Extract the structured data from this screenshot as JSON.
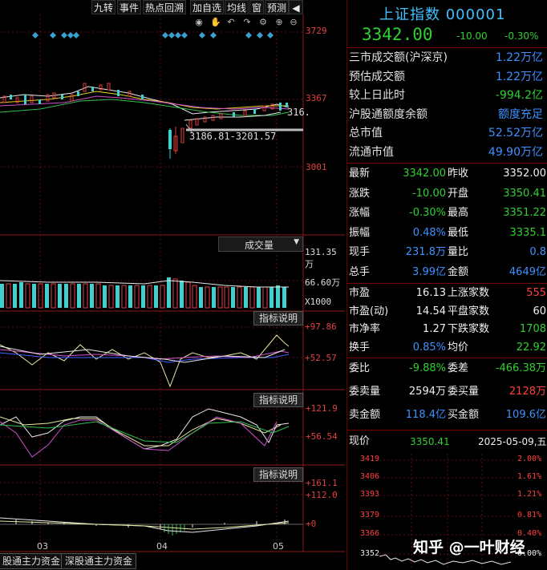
{
  "toolbar": {
    "buttons": [
      "九转",
      "事件",
      "热点回溯",
      "加自选",
      "均线",
      "窗",
      "预测"
    ],
    "icons": [
      "eye-icon",
      "hand-icon",
      "undo-icon",
      "redo-icon",
      "settings-icon",
      "zoom-in-icon",
      "zoom-out-icon"
    ]
  },
  "kline": {
    "y_labels": [
      "3729",
      "3367",
      "3001"
    ],
    "ma_label": "316.",
    "range_label": "3186.81-3201.57"
  },
  "volume": {
    "selector": "成交量",
    "y_labels": [
      "131.35万",
      "66.60万",
      "X1000"
    ]
  },
  "indicator1": {
    "button": "指标说明",
    "y_labels": [
      "+97.86",
      "+52.57"
    ]
  },
  "indicator2": {
    "button": "指标说明",
    "y_labels": [
      "+121.9",
      "+56.54"
    ]
  },
  "indicator3": {
    "button": "指标说明",
    "y_labels": [
      "+161.1",
      "+112.0",
      "+0"
    ]
  },
  "dates": [
    "03",
    "04",
    "05"
  ],
  "bottom_tabs": [
    "股通主力资金",
    "深股通主力资金"
  ],
  "quote": {
    "title": "上证指数 000001",
    "price": "3342.00",
    "change": "-10.00",
    "change_pct": "-0.30%",
    "rows1": [
      {
        "k": "三市成交额(沪深京)",
        "v": "1.22万亿",
        "c": "b"
      },
      {
        "k": "预估成交额",
        "v": "1.22万亿",
        "c": "b"
      },
      {
        "k": "较上日此时",
        "v": "-994.2亿",
        "c": "g"
      },
      {
        "k": "沪股通额度余额",
        "v": "额度充足",
        "c": "b"
      },
      {
        "k": "总市值",
        "v": "52.52万亿",
        "c": "b"
      },
      {
        "k": "流通市值",
        "v": "49.90万亿",
        "c": "b"
      }
    ],
    "grid": [
      {
        "k1": "最新",
        "v1": "3342.00",
        "c1": "g",
        "k2": "昨收",
        "v2": "3352.00",
        "c2": "w"
      },
      {
        "k1": "涨跌",
        "v1": "-10.00",
        "c1": "g",
        "k2": "开盘",
        "v2": "3350.41",
        "c2": "g"
      },
      {
        "k1": "涨幅",
        "v1": "-0.30%",
        "c1": "g",
        "k2": "最高",
        "v2": "3351.22",
        "c2": "g"
      },
      {
        "k1": "振幅",
        "v1": "0.48%",
        "c1": "b",
        "k2": "最低",
        "v2": "3335.1",
        "c2": "g"
      },
      {
        "k1": "现手",
        "v1": "231.8万",
        "c1": "b",
        "k2": "量比",
        "v2": "0.8",
        "c2": "b"
      },
      {
        "k1": "总手",
        "v1": "3.99亿",
        "c1": "b",
        "k2": "金额",
        "v2": "4649亿",
        "c2": "b"
      }
    ],
    "grid2": [
      {
        "k1": "市盈",
        "v1": "16.13",
        "c1": "w",
        "k2": "上涨家数",
        "v2": "555",
        "c2": "r"
      },
      {
        "k1": "市盈(动)",
        "v1": "14.54",
        "c1": "w",
        "k2": "平盘家数",
        "v2": "60",
        "c2": "w"
      },
      {
        "k1": "市净率",
        "v1": "1.27",
        "c1": "w",
        "k2": "下跌家数",
        "v2": "1708",
        "c2": "g"
      },
      {
        "k1": "换手",
        "v1": "0.85%",
        "c1": "b",
        "k2": "均价",
        "v2": "22.92",
        "c2": "g"
      }
    ],
    "grid3": [
      {
        "k1": "委比",
        "v1": "-9.88%",
        "c1": "g",
        "k2": "委差",
        "v2": "-466.38万",
        "c2": "g"
      },
      {
        "k1": "委卖量",
        "v1": "2594万",
        "c1": "w",
        "k2": "委买量",
        "v2": "2128万",
        "c2": "r"
      },
      {
        "k1": "卖金额",
        "v1": "118.4亿",
        "c1": "b",
        "k2": "买金额",
        "v2": "109.6亿",
        "c2": "b"
      }
    ],
    "now_label": "现价",
    "now_value": "3350.41",
    "date": "2025-05-09,五",
    "mini_left": [
      "3419",
      "3406",
      "3393",
      "3379",
      "3366",
      "3352"
    ],
    "mini_right": [
      "2.00%",
      "1.61%",
      "1.21%",
      "0.81%",
      "0.40%",
      "0.00%"
    ]
  },
  "watermark": "知乎 @一叶财经"
}
